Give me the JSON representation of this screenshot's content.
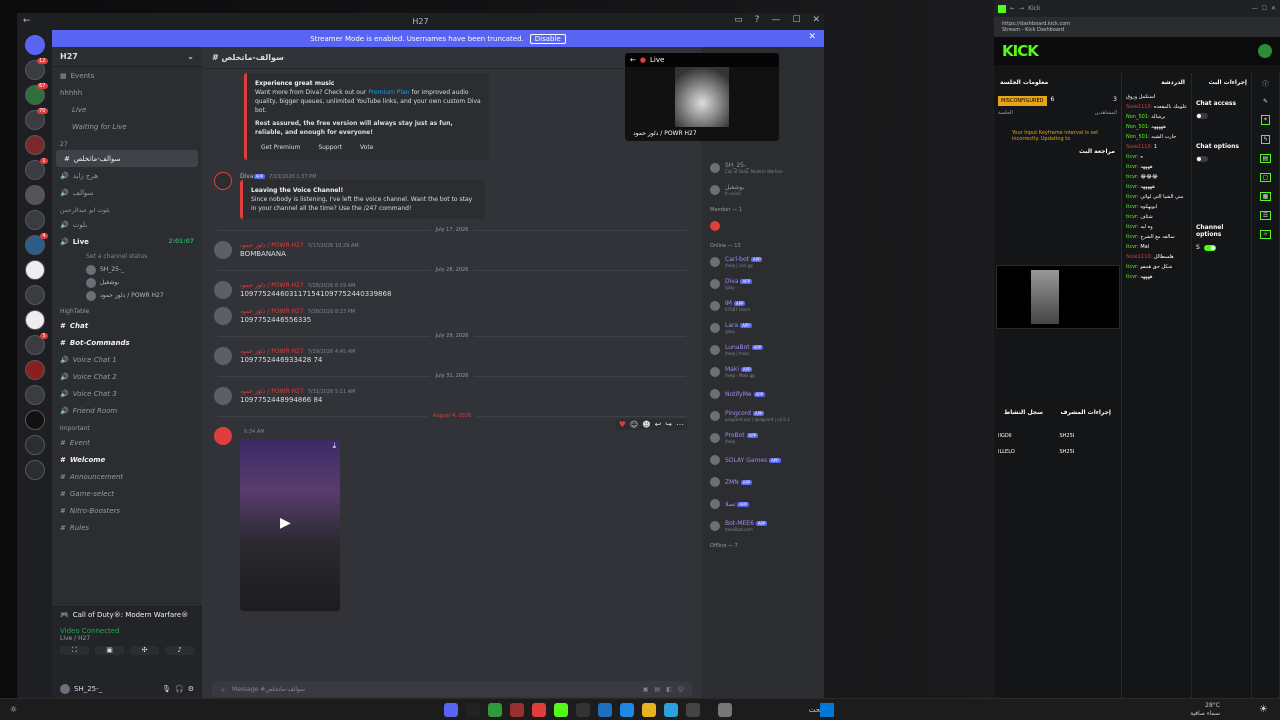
{
  "discord": {
    "title": "H27",
    "banner_text": "Streamer Mode is enabled. Usernames have been truncated.",
    "banner_button": "Disable",
    "guild_name": "H27",
    "channel_header": "سوالف-ماتخلص",
    "channels": {
      "events": "Events",
      "hidden": "hhhhh",
      "live": "Live",
      "waiting": "Waiting for Live",
      "cat_27": "27",
      "selected": "سوالف-ماتخلص",
      "v1": "هرج زايد",
      "v2": "سوالف",
      "cat_b": "بلوت ابو عبدالرحمن",
      "b1": "بلوت",
      "live_voice": "Live",
      "live_time": "2:01:07",
      "status_prompt": "Set a channel status",
      "vu1": "SH_25-_",
      "vu2": "بوشغيل",
      "vu3": "دلوز حمود / POWR H27",
      "cat_high": "HighTable",
      "chat": "Chat",
      "botcmd": "Bot-Commands",
      "vc1": "Voice Chat 1",
      "vc2": "Voice Chat 2",
      "vc3": "Voice Chat 3",
      "friend": "Friend Room",
      "cat_imp": "Important",
      "event": "Event",
      "welcome": "Welcome",
      "announce": "Announcement",
      "gamesel": "Game-select",
      "nitro": "Nitro-Boosters",
      "rules": "Rules"
    },
    "vc_panel": {
      "game": "Call of Duty®: Modern Warfare®",
      "status": "Video Connected",
      "channel": "Live / H27"
    },
    "user": "SH_25-_",
    "embed1": {
      "heading": "Experience great music",
      "body1": "Want more from Diva? Check out our",
      "premium": "Premium Plan",
      "body2": "for improved audio quality, bigger queues, unlimited YouTube links, and your own custom Diva bot.",
      "body3": "Rest assured, the free version will always stay just as fun, reliable, and enough for everyone!",
      "btn1": "Get Premium",
      "btn2": "Support",
      "btn3": "Vote"
    },
    "diva_msg": {
      "name": "Diva",
      "time": "7/13/2026 1:37 PM",
      "title": "Leaving the Voice Channel!",
      "text": "Since nobody is listening, I've left the voice channel. Want the bot to stay in your channel all the time? Use the /247 command!"
    },
    "dates": [
      "July 17, 2026",
      "July 28, 2026",
      "July 29, 2026",
      "July 31, 2026",
      "August 4, 2026"
    ],
    "messages": [
      {
        "name": "دلوز حمود / POWR H27",
        "time": "7/17/2026 10:29 AM",
        "text": "BOMBANANA"
      },
      {
        "name": "دلوز حمود / POWR H27",
        "time": "7/28/2026 8:19 AM",
        "text": "1097752446031171541097752440339868"
      },
      {
        "name": "دلوز حمود / POWR H27",
        "time": "7/28/2026 8:23 PM",
        "text": "1097752446556335"
      },
      {
        "name": "دلوز حمود / POWR H27",
        "time": "7/29/2026 4:45 AM",
        "text": "1097752446933428 74"
      },
      {
        "name": "دلوز حمود / POWR H27",
        "time": "7/31/2026 5:11 AM",
        "text": "1097752448994866 84"
      }
    ],
    "last_msg_time": "6:34 AM",
    "composer": "Message #سوالف-ماتخلص",
    "stream": {
      "label": "Live",
      "caption": "دلوز حمود / POWR H27"
    },
    "members": {
      "member_group": "Member — 1",
      "online_group": "Online — 13",
      "offline_group": "Offline — 7",
      "list": [
        {
          "name": "Carl-bot",
          "sub": "/help | carl.gg"
        },
        {
          "name": "Diva",
          "sub": "/play"
        },
        {
          "name": "IM",
          "sub": "67087 Users"
        },
        {
          "name": "Lara",
          "sub": "/play"
        },
        {
          "name": "LunaBot",
          "sub": "/help | /help"
        },
        {
          "name": "Maki",
          "sub": "/help - Maki.gg"
        },
        {
          "name": "NotifyMe",
          "sub": ""
        },
        {
          "name": "Pingcord",
          "sub": "pingcord.xyz | /pingcord | v2.0.1"
        },
        {
          "name": "ProBot",
          "sub": "/help"
        },
        {
          "name": "SOLAY Games",
          "sub": ""
        },
        {
          "name": "ZMN",
          "sub": ""
        },
        {
          "name": "تصلا",
          "sub": ""
        },
        {
          "name": "Bot-MEE6",
          "sub": "mee6bot.com"
        }
      ],
      "top": [
        {
          "name": "SH_25-_",
          "sub": "Call of Duty: Modern Warfare"
        },
        {
          "name": "بوشغيل",
          "sub": "In voice"
        }
      ]
    }
  },
  "kick": {
    "tab": "Kick",
    "url": "https://dashboard.kick.com",
    "url_sub": "Stream - Kick Dashboard",
    "logo": "KICK",
    "session_info": "معلومات الجلسة",
    "misconfigured": "MISCONFIGURED",
    "viewers_count": "6",
    "viewers_label": "المشاهدين",
    "session_label": "الجلسة",
    "followers_count": "3",
    "keyframe_warning": "Your Input Keyframe interval is set incorrectly. Updating to",
    "stream_review": "مراجعة البث",
    "chat_title": "الدردشة",
    "chat_lines": [
      {
        "u": "",
        "t": "استكمل وروق"
      },
      {
        "u": "Sose1110:",
        "t": "علومك بالمقعده"
      },
      {
        "u": "Non_501:",
        "t": "برشالة"
      },
      {
        "u": "Non_501:",
        "t": "هههههه"
      },
      {
        "u": "Non_501:",
        "t": "جارت الشيه"
      },
      {
        "u": "Sose1110:",
        "t": "1"
      },
      {
        "u": "ticvr:",
        "t": "ه"
      },
      {
        "u": "ticvr:",
        "t": "ههههه"
      },
      {
        "u": "ticvr:",
        "t": "😂😂😂"
      },
      {
        "u": "ticvr:",
        "t": "هههههه"
      },
      {
        "u": "ticvr:",
        "t": "مني الشيا التي لوائي"
      },
      {
        "u": "ticvr:",
        "t": "ابويهكوه"
      },
      {
        "u": "ticvr:",
        "t": "شئاف"
      },
      {
        "u": "ticvr:",
        "t": "وه ليه"
      },
      {
        "u": "ticvr:",
        "t": "سالفه مع الشرح"
      },
      {
        "u": "ticvr:",
        "t": "Mal"
      },
      {
        "u": "Sose1110:",
        "t": "هلسطالل"
      },
      {
        "u": "ticvr:",
        "t": "شكل حق هنيفو"
      },
      {
        "u": "ticvr:",
        "t": "ههههه"
      }
    ],
    "stream_actions": "إجراءات البث",
    "chat_access": "Chat access",
    "chat_options": "Chat options",
    "channel_options": "Channel options",
    "mod_actions": "إجراءات المشرف",
    "recent_log": "سجل النشاط",
    "log_items": [
      "IIGDII",
      "SH25I",
      "ILLELO",
      "SH25I"
    ],
    "side_label": "الملف الشخصي",
    "footer_label": "S"
  },
  "taskbar": {
    "weather": "28°C",
    "weather_sub": "سماء صافية",
    "search": "بحث"
  },
  "colors": {
    "discord_blurple": "#5865f2",
    "kick_green": "#53fc18",
    "live_red": "#e03d3d"
  }
}
